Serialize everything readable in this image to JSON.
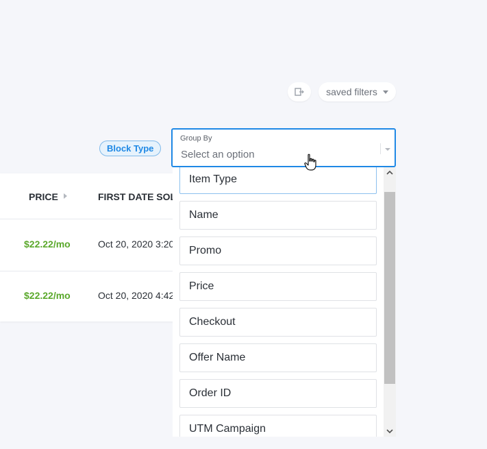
{
  "toolbar": {
    "export_icon": "export-icon",
    "saved_filters_label": "saved filters"
  },
  "filter_chip": {
    "label": "Block Type"
  },
  "table": {
    "columns": [
      "PRICE",
      "FIRST DATE SOLD"
    ],
    "rows": [
      {
        "price": "$22.22/mo",
        "first_date_sold": "Oct 20, 2020 3:20"
      },
      {
        "price": "$22.22/mo",
        "first_date_sold": "Oct 20, 2020 4:42"
      }
    ]
  },
  "group_by": {
    "label": "Group By",
    "placeholder": "Select an option",
    "options": [
      "Item Type",
      "Name",
      "Promo",
      "Price",
      "Checkout",
      "Offer Name",
      "Order ID",
      "UTM Campaign"
    ]
  },
  "colors": {
    "accent": "#1e88e5",
    "price_green": "#5aa82b",
    "background": "#f5f6fa"
  }
}
